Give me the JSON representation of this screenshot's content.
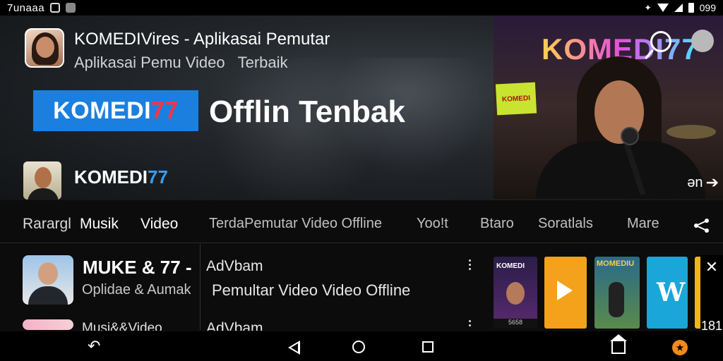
{
  "status_bar": {
    "time": "7unaaa"
  },
  "app": {
    "title": "KOMEDIVires - Aplikasai Pemutar",
    "subtitle_a": "Aplikasai Pemu Video",
    "subtitle_b": "Terbaik"
  },
  "hero": {
    "brand_blue": "KOMEDI",
    "brand_red": "77",
    "headline": "Offlin Tenbak"
  },
  "channel": {
    "name_a": "KOMEDI",
    "name_b": "77"
  },
  "video": {
    "logo": "KOMEDI77",
    "sign": "KOMEDI",
    "time": "ən"
  },
  "tabs": [
    {
      "label": "Rarargl"
    },
    {
      "label": "Musik"
    },
    {
      "label": "Video"
    },
    {
      "label": "TerdaPemutar Video Offline"
    },
    {
      "label": "Yoo!t"
    },
    {
      "label": "Btaro"
    },
    {
      "label": "Soratlals"
    },
    {
      "label": "Mare"
    }
  ],
  "list": [
    {
      "title": "MUKE & 77 -",
      "subtitle": "Oplidae & Aumak",
      "mid_title": "AdVbam",
      "mid_sub": "Pemultar Video Video Offline"
    },
    {
      "title": "Musi&&Video",
      "mid_title": "AdVbam"
    }
  ],
  "posters": [
    {
      "title": "KOMEDI",
      "label": "5658"
    },
    {
      "title": ""
    },
    {
      "title": "MOMEDIU"
    },
    {
      "title": "W"
    },
    {
      "title": ""
    }
  ],
  "close_panel": {
    "count": "181"
  },
  "colors": {
    "brand_blue": "#1b7fe0",
    "brand_red": "#ff3340",
    "accent_orange": "#f18a1a"
  }
}
